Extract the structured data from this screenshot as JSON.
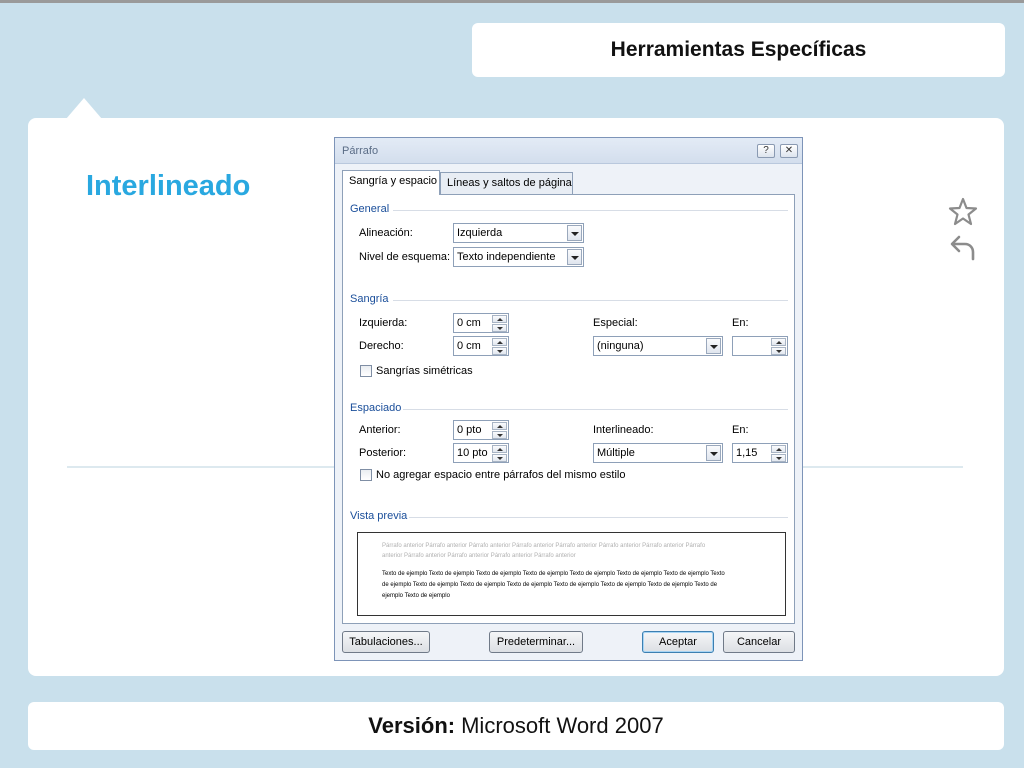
{
  "slide": {
    "header_title": "Herramientas Específicas",
    "title": "Interlineado",
    "version_label": "Versión:",
    "version_value": "Microsoft Word 2007",
    "icons": [
      "star-icon",
      "undo-arrow-icon"
    ]
  },
  "dialog": {
    "title": "Párrafo",
    "help_button": "?",
    "close_button": "✕",
    "tabs": [
      "Sangría y espacio",
      "Líneas y saltos de página"
    ],
    "general": {
      "section_label": "General",
      "alignment_label": "Alineación:",
      "alignment_value": "Izquierda",
      "outline_label": "Nivel de esquema:",
      "outline_value": "Texto independiente"
    },
    "indent": {
      "section_label": "Sangría",
      "left_label": "Izquierda:",
      "left_value": "0 cm",
      "right_label": "Derecho:",
      "right_value": "0 cm",
      "special_label": "Especial:",
      "special_value": "(ninguna)",
      "by_label": "En:",
      "by_value": "",
      "mirror_label": "Sangrías simétricas"
    },
    "spacing": {
      "section_label": "Espaciado",
      "before_label": "Anterior:",
      "before_value": "0 pto",
      "after_label": "Posterior:",
      "after_value": "10 pto",
      "line_label": "Interlineado:",
      "line_value": "Múltiple",
      "at_label": "En:",
      "at_value": "1,15",
      "no_space_label": "No agregar espacio entre párrafos del mismo estilo"
    },
    "preview": {
      "section_label": "Vista previa",
      "previous_line1": "Párrafo anterior Párrafo anterior Párrafo anterior Párrafo anterior Párrafo anterior Párrafo anterior Párrafo anterior Párrafo",
      "previous_line2": "anterior Párrafo anterior Párrafo anterior Párrafo anterior Párrafo anterior",
      "sample_line1": "Texto de ejemplo Texto de ejemplo Texto de ejemplo Texto de ejemplo Texto de ejemplo Texto de ejemplo Texto de ejemplo Texto",
      "sample_line2": "de ejemplo Texto de ejemplo Texto de ejemplo Texto de ejemplo Texto de ejemplo Texto de ejemplo Texto de ejemplo Texto de",
      "sample_line3": "ejemplo Texto de ejemplo"
    },
    "buttons": {
      "tabs": "Tabulaciones...",
      "default": "Predeterminar...",
      "ok": "Aceptar",
      "cancel": "Cancelar"
    }
  }
}
